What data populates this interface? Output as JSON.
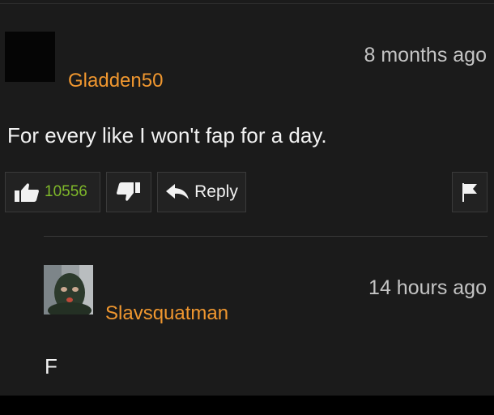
{
  "comment": {
    "username": "Gladden50",
    "timestamp": "8 months ago",
    "text": "For every like I won't fap for a day.",
    "likes": "10556",
    "reply_label": "Reply"
  },
  "reply": {
    "username": "Slavsquatman",
    "timestamp": "14 hours ago",
    "text": "F"
  },
  "colors": {
    "username": "#f0972f",
    "likes": "#7fb82a",
    "background": "#1b1b1b"
  },
  "icons": {
    "like": "thumbs-up-icon",
    "dislike": "thumbs-down-icon",
    "reply": "reply-arrow-icon",
    "flag": "flag-icon"
  }
}
